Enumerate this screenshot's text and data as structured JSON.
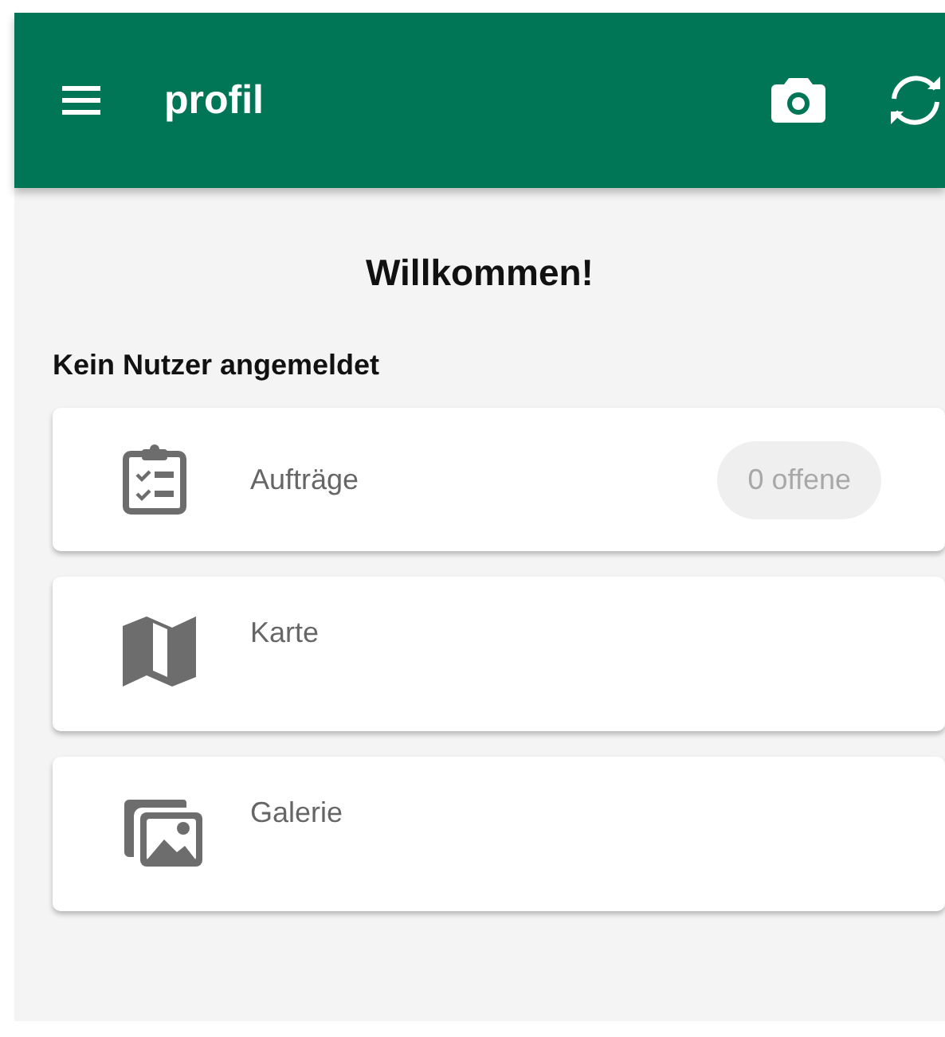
{
  "app_bar": {
    "title": "profil"
  },
  "welcome": "Willkommen!",
  "user_status": "Kein Nutzer angemeldet",
  "items": [
    {
      "label": "Aufträge",
      "badge": "0 offene"
    },
    {
      "label": "Karte"
    },
    {
      "label": "Galerie"
    }
  ]
}
